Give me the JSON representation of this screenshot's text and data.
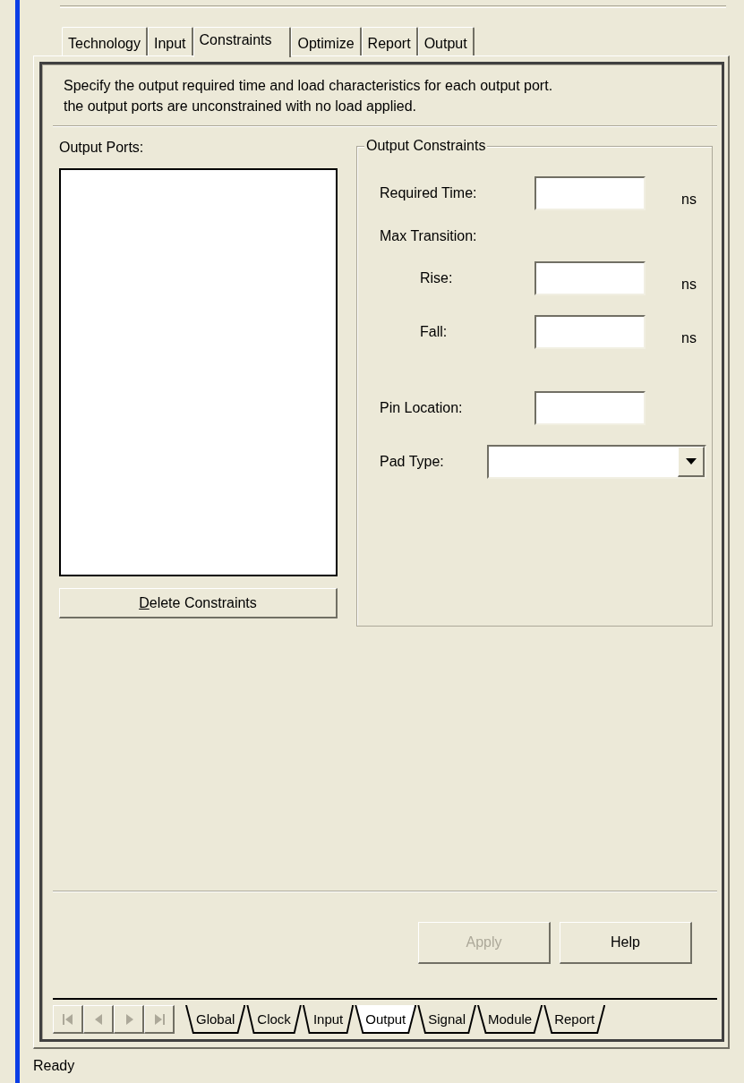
{
  "top_tabs": [
    {
      "label": "Technology",
      "selected": false
    },
    {
      "label": "Input",
      "selected": false
    },
    {
      "label": "Constraints",
      "selected": true
    },
    {
      "label": "Optimize",
      "selected": false
    },
    {
      "label": "Report",
      "selected": false
    },
    {
      "label": "Output",
      "selected": false
    }
  ],
  "description": [
    "Specify the output required time and load characteristics for each output port.",
    "the output ports are unconstrained with no load applied."
  ],
  "output_ports": {
    "label": "Output Ports:",
    "delete_button": {
      "label": "Delete Constraints",
      "access_key_underlined": true
    }
  },
  "output_constraints": {
    "title": "Output Constraints",
    "fields": [
      {
        "kind": "text",
        "label": "Required Time:",
        "unit": "ns"
      },
      {
        "kind": "heading",
        "label": "Max Transition:",
        "children": [
          {
            "kind": "text",
            "label": "Rise:",
            "unit": "ns"
          },
          {
            "kind": "text",
            "label": "Fall:",
            "unit": "ns"
          }
        ]
      },
      {
        "kind": "text",
        "label": "Pin Location:"
      },
      {
        "kind": "select",
        "label": "Pad Type:"
      }
    ]
  },
  "buttons": [
    {
      "label": "Apply",
      "disabled": true
    },
    {
      "label": "Help",
      "disabled": false
    }
  ],
  "sheet_nav": [
    {
      "kind": "first",
      "disabled": true
    },
    {
      "kind": "prev",
      "disabled": true
    },
    {
      "kind": "next",
      "disabled": true
    },
    {
      "kind": "last",
      "disabled": true
    }
  ],
  "sheet_tabs": [
    {
      "label": "Global",
      "selected": false
    },
    {
      "label": "Clock",
      "selected": false
    },
    {
      "label": "Input",
      "selected": false
    },
    {
      "label": "Output",
      "selected": true
    },
    {
      "label": "Signal",
      "selected": false
    },
    {
      "label": "Module",
      "selected": false
    },
    {
      "label": "Report",
      "selected": false
    }
  ],
  "status_bar": "Ready"
}
